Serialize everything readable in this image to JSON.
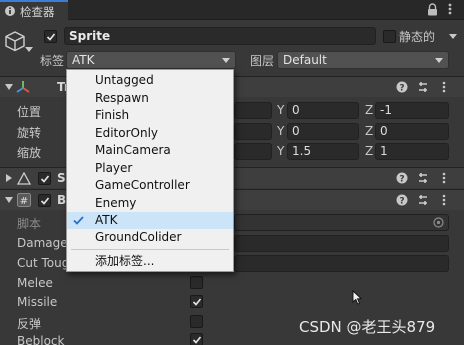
{
  "window": {
    "tab_label": "检查器"
  },
  "object": {
    "name": "Sprite",
    "static_label": "静态的",
    "tag_label": "标签",
    "tag_value": "ATK",
    "layer_label": "图层",
    "layer_value": "Default"
  },
  "transform": {
    "header_initial": "Tr",
    "rows": [
      {
        "label": "位置",
        "y": "0",
        "z": "-1"
      },
      {
        "label": "旋转",
        "y": "0",
        "z": "0"
      },
      {
        "label": "缩放",
        "y": "1.5",
        "z": "1"
      }
    ],
    "axis_y": "Y",
    "axis_z": "Z"
  },
  "components": [
    {
      "header_initial": "Sp"
    },
    {
      "header_initial": "Be"
    }
  ],
  "script_section": {
    "script_label": "脚本",
    "fields": [
      {
        "label": "Damage",
        "type": "text"
      },
      {
        "label": "Cut Toug",
        "type": "text"
      },
      {
        "label": "Melee",
        "type": "checkbox",
        "checked": false
      },
      {
        "label": "Missile",
        "type": "checkbox",
        "checked": true
      },
      {
        "label": "反弹",
        "type": "checkbox",
        "checked": false
      },
      {
        "label": "Beblock",
        "type": "checkbox",
        "checked": true
      }
    ]
  },
  "tag_menu": {
    "items": [
      "Untagged",
      "Respawn",
      "Finish",
      "EditorOnly",
      "MainCamera",
      "Player",
      "GameController",
      "Enemy",
      "ATK",
      "GroundColider"
    ],
    "selected": "ATK",
    "add_tag": "添加标签..."
  },
  "watermark": "CSDN @老王头879",
  "colors": {
    "accent": "#3d7dd6",
    "menu_bg": "#f0f0f0",
    "menu_selected": "#cce4f7",
    "panel_bg": "#383838"
  }
}
